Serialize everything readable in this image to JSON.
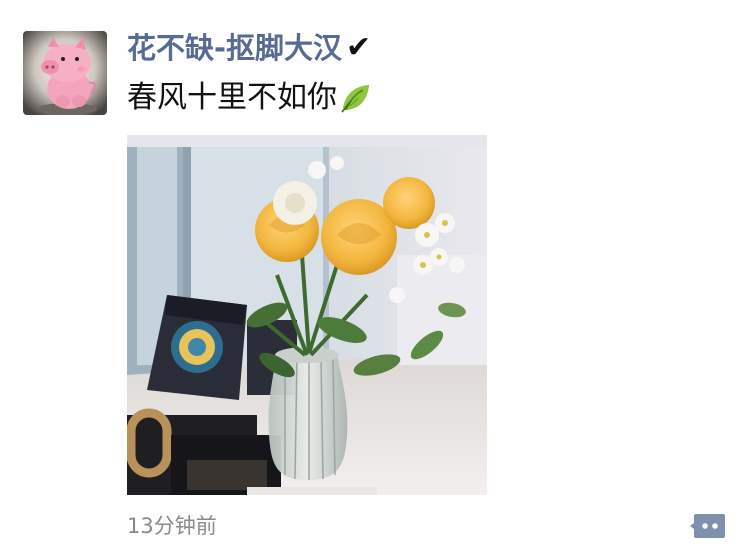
{
  "post": {
    "author": "花不缺-抠脚大汉",
    "author_mark": "✔",
    "text": "春风十里不如你",
    "timestamp": "13分钟前"
  },
  "colors": {
    "author_name": "#576b95",
    "timestamp": "#8a8a8a",
    "comment_button": "#7f8fae"
  },
  "icons": {
    "avatar": "pink-pig-avatar",
    "text_emoji": "leaf-icon",
    "comment": "comment-icon"
  }
}
